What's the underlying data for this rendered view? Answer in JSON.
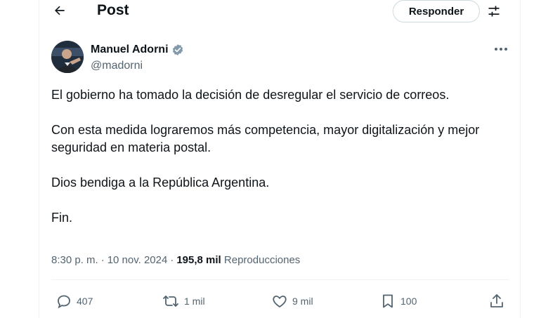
{
  "header": {
    "title": "Post",
    "reply_button": "Responder",
    "back_icon": "arrow-left-icon",
    "filter_icon": "sliders-icon"
  },
  "author": {
    "name": "Manuel Adorni",
    "handle": "@madorni",
    "verified_icon": "verified-badge-icon",
    "verified_color": "#829aab"
  },
  "post": {
    "paragraphs": [
      "El gobierno ha tomado la decisión de desregular el servicio de correos.",
      "Con esta medida lograremos más competencia, mayor digitalización y mejor seguridad en materia postal.",
      "Dios bendiga a la República Argentina.",
      "Fin."
    ],
    "time": "8:30 p. m.",
    "date": "10 nov. 2024",
    "views": "195,8 mil",
    "views_label": "Reproducciones"
  },
  "actions": {
    "replies": "407",
    "reposts": "1 mil",
    "likes": "9 mil",
    "bookmarks": "100"
  },
  "colors": {
    "text": "#0f1419",
    "secondary": "#536471",
    "border": "#eff3f4"
  }
}
